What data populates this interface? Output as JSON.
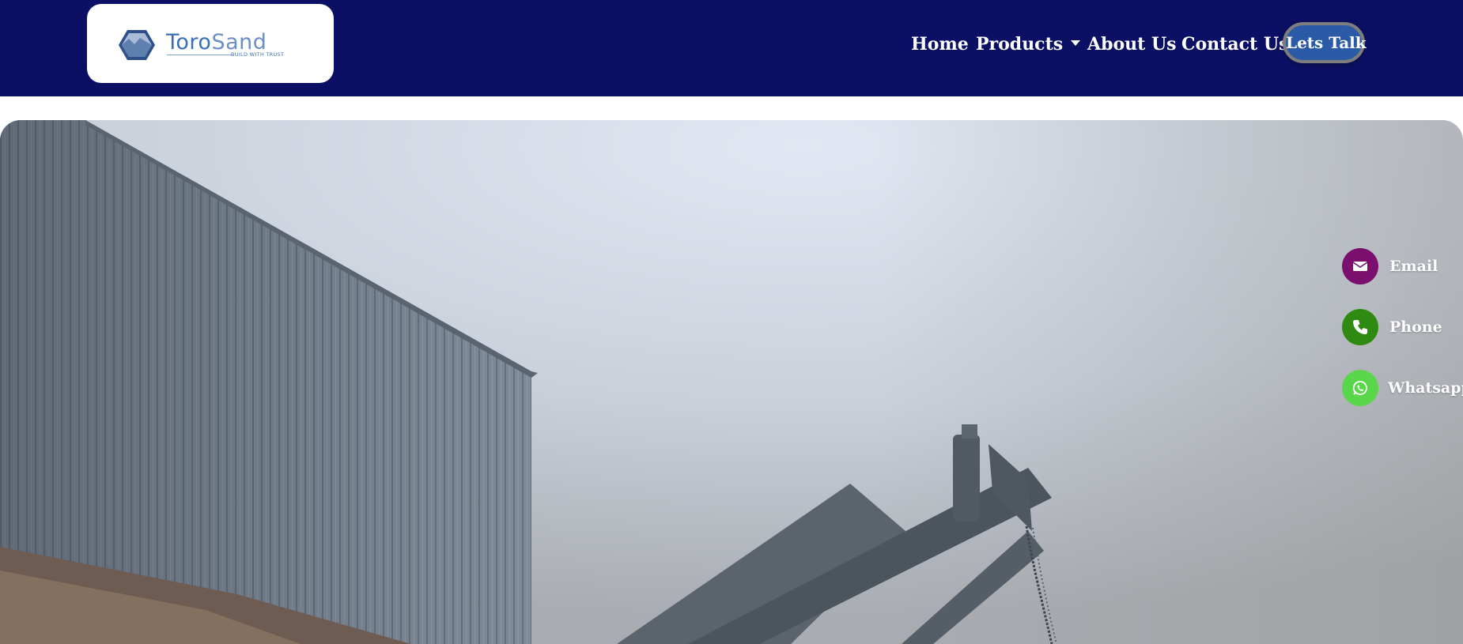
{
  "brand": {
    "name_first": "Toro",
    "name_second": "Sand",
    "tagline": "BUILD WITH TRUST",
    "icon": "hexagon-logo-icon"
  },
  "nav": {
    "home": "Home",
    "products": "Products",
    "about": "About Us",
    "contact": "Contact Us",
    "cta": "Lets Talk"
  },
  "floating_contacts": {
    "email": {
      "label": "Email",
      "color": "#7a0f6e",
      "icon": "envelope-icon"
    },
    "phone": {
      "label": "Phone",
      "color": "#2f8a12",
      "icon": "phone-icon"
    },
    "whatsapp": {
      "label": "Whatsapp",
      "color": "#5ad64a",
      "icon": "whatsapp-icon"
    }
  },
  "hero": {
    "image": "sand manufacturing plant with conveyor belt under hazy sky"
  },
  "colors": {
    "navbar": "#0b1064",
    "cta_button": "#2b5ba6",
    "brand_blue": "#3b6fb5"
  }
}
